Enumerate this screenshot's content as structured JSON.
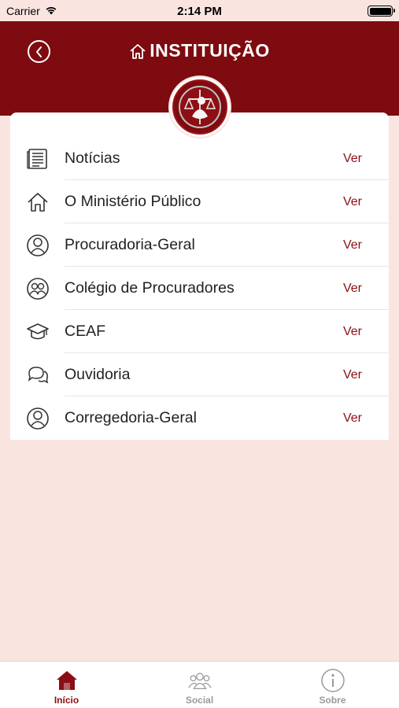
{
  "status_bar": {
    "carrier": "Carrier",
    "time": "2:14 PM"
  },
  "header": {
    "title": "INSTITUIÇÃO"
  },
  "list": [
    {
      "label": "Notícias",
      "action": "Ver",
      "icon": "newspaper-icon"
    },
    {
      "label": "O Ministério Público",
      "action": "Ver",
      "icon": "house-icon"
    },
    {
      "label": "Procuradoria-Geral",
      "action": "Ver",
      "icon": "person-icon"
    },
    {
      "label": "Colégio de Procuradores",
      "action": "Ver",
      "icon": "group-icon"
    },
    {
      "label": "CEAF",
      "action": "Ver",
      "icon": "graduation-cap-icon"
    },
    {
      "label": "Ouvidoria",
      "action": "Ver",
      "icon": "chat-bubbles-icon"
    },
    {
      "label": "Corregedoria-Geral",
      "action": "Ver",
      "icon": "person-icon"
    }
  ],
  "tabbar": [
    {
      "label": "Início",
      "active": true,
      "icon": "home-icon"
    },
    {
      "label": "Social",
      "active": false,
      "icon": "people-icon"
    },
    {
      "label": "Sobre",
      "active": false,
      "icon": "info-icon"
    }
  ],
  "colors": {
    "primary": "#7d0b10",
    "background": "#f9e4e0",
    "accent_text": "#8a0f14"
  }
}
